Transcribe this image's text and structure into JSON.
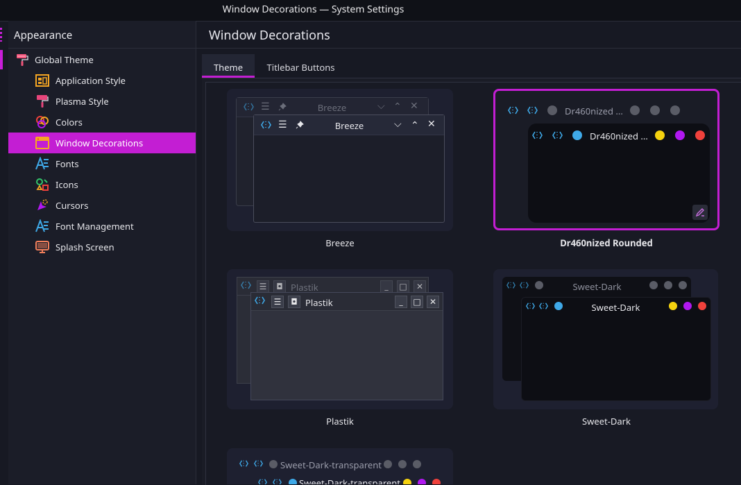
{
  "window": {
    "title": "Window Decorations — System Settings"
  },
  "sidebar": {
    "header": "Appearance",
    "items": [
      {
        "label": "Global Theme",
        "icon": "paint-roller-icon"
      },
      {
        "label": "Application Style",
        "icon": "application-style-icon"
      },
      {
        "label": "Plasma Style",
        "icon": "paint-brush-icon"
      },
      {
        "label": "Colors",
        "icon": "color-circles-icon"
      },
      {
        "label": "Window Decorations",
        "icon": "window-frame-icon"
      },
      {
        "label": "Fonts",
        "icon": "font-icon"
      },
      {
        "label": "Icons",
        "icon": "shapes-icon"
      },
      {
        "label": "Cursors",
        "icon": "cursor-icon"
      },
      {
        "label": "Font Management",
        "icon": "font-management-icon"
      },
      {
        "label": "Splash Screen",
        "icon": "monitor-icon"
      }
    ]
  },
  "main": {
    "title": "Window Decorations",
    "tabs": [
      "Theme",
      "Titlebar Buttons"
    ]
  },
  "themes": [
    {
      "name": "Breeze",
      "preview_title": "Breeze"
    },
    {
      "name": "Dr460nized Rounded",
      "preview_title": "Dr460nized ..."
    },
    {
      "name": "Plastik",
      "preview_title": "Plastik"
    },
    {
      "name": "Sweet-Dark",
      "preview_title": "Sweet-Dark"
    },
    {
      "name": "Sweet-Dark-transparent",
      "preview_title": "Sweet-Dark-transparent"
    }
  ],
  "colors": {
    "accent": "#c31ed3",
    "yellow": "#f5d20f",
    "purple": "#b118f0",
    "red": "#f0413c",
    "cyan": "#3fa9e8"
  }
}
